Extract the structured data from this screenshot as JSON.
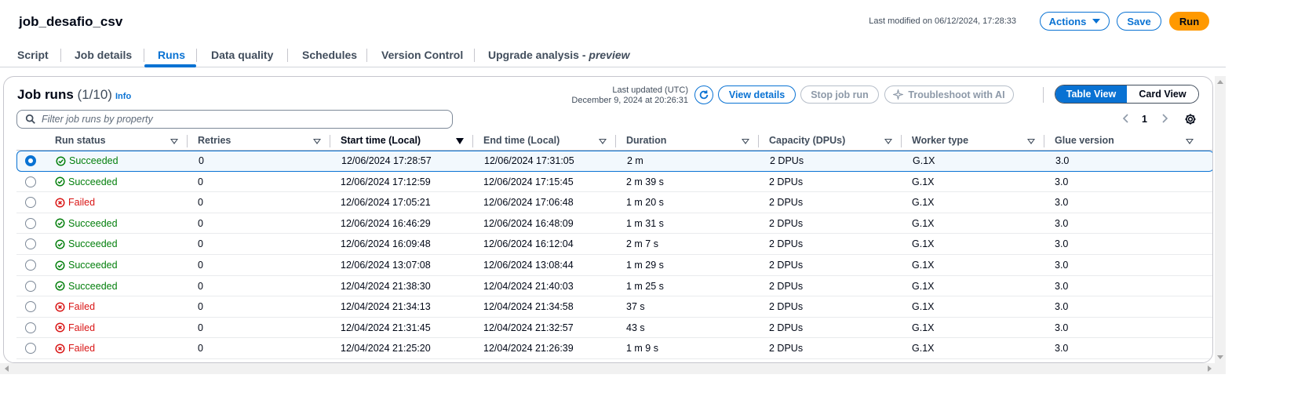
{
  "header": {
    "job_name": "job_desafio_csv",
    "last_modified": "Last modified on 06/12/2024, 17:28:33",
    "actions_label": "Actions",
    "save_label": "Save",
    "run_label": "Run"
  },
  "tabs": [
    {
      "label": "Script"
    },
    {
      "label": "Job details"
    },
    {
      "label": "Runs",
      "active": true
    },
    {
      "label": "Data quality"
    },
    {
      "label": "Schedules"
    },
    {
      "label": "Version Control"
    },
    {
      "label": "Upgrade analysis - ",
      "suffix": "preview"
    }
  ],
  "panel": {
    "title": "Job runs",
    "count": "(1/10)",
    "info": "Info",
    "last_updated_line1": "Last updated (UTC)",
    "last_updated_line2": "December 9, 2024 at 20:26:31",
    "view_details": "View details",
    "stop_job_run": "Stop job run",
    "troubleshoot": "Troubleshoot with AI",
    "table_view": "Table View",
    "card_view": "Card View",
    "filter_placeholder": "Filter job runs by property",
    "page": "1"
  },
  "table": {
    "columns": [
      "Run status",
      "Retries",
      "Start time (Local)",
      "End time (Local)",
      "Duration",
      "Capacity (DPUs)",
      "Worker type",
      "Glue version"
    ],
    "rows": [
      {
        "status": "Succeeded",
        "ok": true,
        "retries": "0",
        "start": "12/06/2024 17:28:57",
        "end": "12/06/2024 17:31:05",
        "duration": "2 m",
        "capacity": "2 DPUs",
        "worker": "G.1X",
        "glue": "3.0",
        "selected": true
      },
      {
        "status": "Succeeded",
        "ok": true,
        "retries": "0",
        "start": "12/06/2024 17:12:59",
        "end": "12/06/2024 17:15:45",
        "duration": "2 m 39 s",
        "capacity": "2 DPUs",
        "worker": "G.1X",
        "glue": "3.0"
      },
      {
        "status": "Failed",
        "ok": false,
        "retries": "0",
        "start": "12/06/2024 17:05:21",
        "end": "12/06/2024 17:06:48",
        "duration": "1 m 20 s",
        "capacity": "2 DPUs",
        "worker": "G.1X",
        "glue": "3.0"
      },
      {
        "status": "Succeeded",
        "ok": true,
        "retries": "0",
        "start": "12/06/2024 16:46:29",
        "end": "12/06/2024 16:48:09",
        "duration": "1 m 31 s",
        "capacity": "2 DPUs",
        "worker": "G.1X",
        "glue": "3.0"
      },
      {
        "status": "Succeeded",
        "ok": true,
        "retries": "0",
        "start": "12/06/2024 16:09:48",
        "end": "12/06/2024 16:12:04",
        "duration": "2 m 7 s",
        "capacity": "2 DPUs",
        "worker": "G.1X",
        "glue": "3.0"
      },
      {
        "status": "Succeeded",
        "ok": true,
        "retries": "0",
        "start": "12/06/2024 13:07:08",
        "end": "12/06/2024 13:08:44",
        "duration": "1 m 29 s",
        "capacity": "2 DPUs",
        "worker": "G.1X",
        "glue": "3.0"
      },
      {
        "status": "Succeeded",
        "ok": true,
        "retries": "0",
        "start": "12/04/2024 21:38:30",
        "end": "12/04/2024 21:40:03",
        "duration": "1 m 25 s",
        "capacity": "2 DPUs",
        "worker": "G.1X",
        "glue": "3.0"
      },
      {
        "status": "Failed",
        "ok": false,
        "retries": "0",
        "start": "12/04/2024 21:34:13",
        "end": "12/04/2024 21:34:58",
        "duration": "37 s",
        "capacity": "2 DPUs",
        "worker": "G.1X",
        "glue": "3.0"
      },
      {
        "status": "Failed",
        "ok": false,
        "retries": "0",
        "start": "12/04/2024 21:31:45",
        "end": "12/04/2024 21:32:57",
        "duration": "43 s",
        "capacity": "2 DPUs",
        "worker": "G.1X",
        "glue": "3.0"
      },
      {
        "status": "Failed",
        "ok": false,
        "retries": "0",
        "start": "12/04/2024 21:25:20",
        "end": "12/04/2024 21:26:39",
        "duration": "1 m 9 s",
        "capacity": "2 DPUs",
        "worker": "G.1X",
        "glue": "3.0"
      }
    ]
  },
  "colors": {
    "accent": "#0972d3",
    "run_button": "#ff9900",
    "success": "#037f0c",
    "error": "#d91515"
  }
}
